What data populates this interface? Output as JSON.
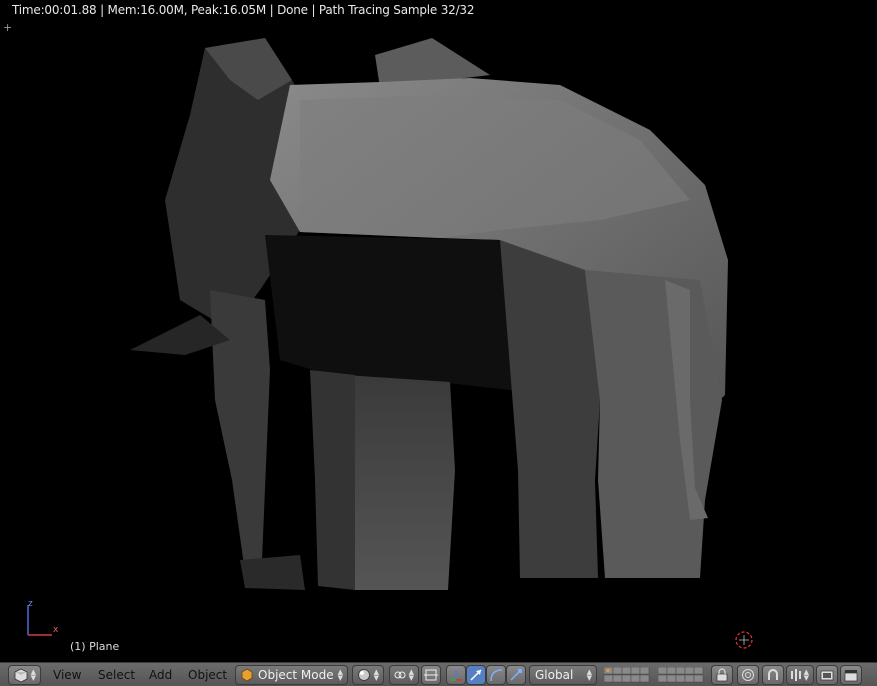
{
  "render_info": "Time:00:01.88 | Mem:16.00M, Peak:16.05M | Done | Path Tracing Sample 32/32",
  "object_label": "(1) Plane",
  "axis": {
    "z": "z",
    "x": "x"
  },
  "header": {
    "menus": {
      "view": "View",
      "select": "Select",
      "add": "Add",
      "object": "Object"
    },
    "mode": "Object Mode",
    "orientation": "Global"
  },
  "colors": {
    "header_bg": "#5f5f5f",
    "viewport_bg": "#000000",
    "active_blue": "#5680c2"
  },
  "icons": [
    "editor-type-icon",
    "object-mode-icon",
    "shading-sphere-icon",
    "pivot-icon",
    "transform-widget-icon",
    "translate-icon",
    "rotate-icon",
    "scale-icon",
    "layers-icon",
    "lock-icon",
    "proportional-icon",
    "snap-magnet-icon",
    "snap-element-icon",
    "render-icon",
    "clapper-icon"
  ]
}
